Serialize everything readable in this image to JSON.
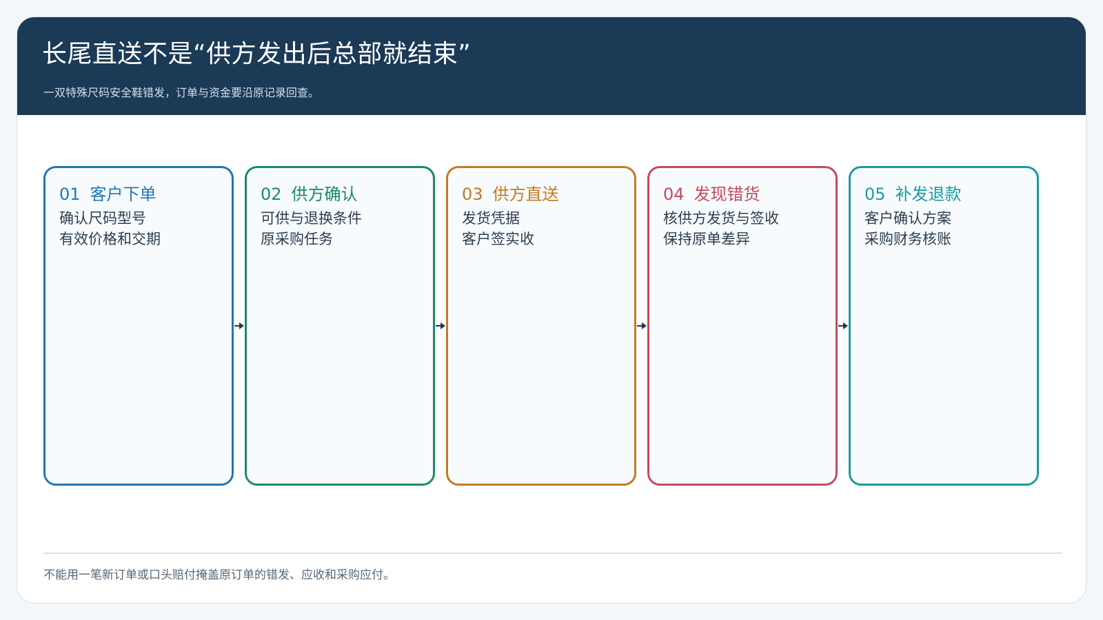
{
  "title": "长尾直送不是“供方发出后总部就结束”",
  "subtitle": "一双特殊尺码安全鞋错发，订单与资金要沿原记录回查。",
  "steps": [
    {
      "num": "01",
      "title": "客户下单",
      "color": "#1f77b4",
      "lines": [
        "确认尺码型号",
        "有效价格和交期"
      ]
    },
    {
      "num": "02",
      "title": "供方确认",
      "color": "#1a8a66",
      "lines": [
        "可供与退换条件",
        "原采购任务"
      ]
    },
    {
      "num": "03",
      "title": "供方直送",
      "color": "#c47a22",
      "lines": [
        "发货凭据",
        "客户签实收"
      ]
    },
    {
      "num": "04",
      "title": "发现错货",
      "color": "#c44a5c",
      "lines": [
        "核供方发货与签收",
        "保持原单差异"
      ]
    },
    {
      "num": "05",
      "title": "补发退款",
      "color": "#1a9aa0",
      "lines": [
        "客户确认方案",
        "采购财务核账"
      ]
    }
  ],
  "arrow_icon": "arrow-right-icon",
  "footer": "不能用一笔新订单或口头赔付掩盖原订单的错发、应收和采购应付。"
}
